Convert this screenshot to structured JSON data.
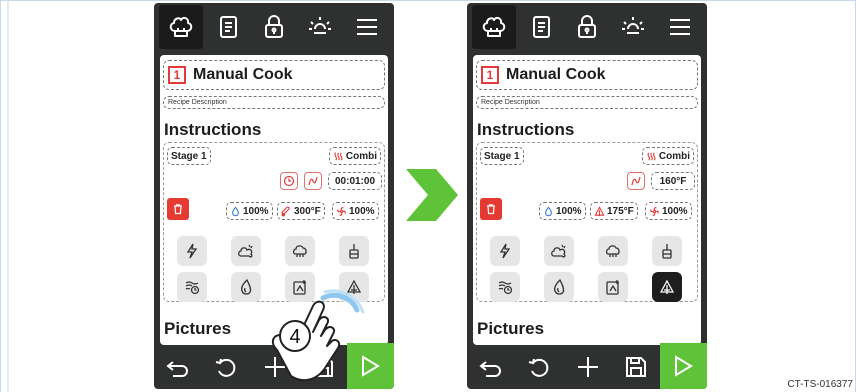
{
  "caption": "CT-TS-016377",
  "colors": {
    "accent_red": "#e03a3a",
    "play_green": "#5fc33a",
    "arrow_green": "#5fc33a",
    "frame_dark": "#2f3030"
  },
  "left": {
    "title_number": "1",
    "title": "Manual Cook",
    "description_placeholder": "Recipe Description",
    "instructions_heading": "Instructions",
    "stage_label": "Stage 1",
    "mode_label": "Combi",
    "timer_value": "00:01:00",
    "humidity_value": "100%",
    "temperature_value": "300°F",
    "fan_value": "100%",
    "pictures_heading": "Pictures",
    "step_badge": "4",
    "active_mode": "delta-t"
  },
  "right": {
    "title_number": "1",
    "title": "Manual Cook",
    "description_placeholder": "Recipe Description",
    "instructions_heading": "Instructions",
    "stage_label": "Stage 1",
    "mode_label": "Combi",
    "core_temp_value": "160°F",
    "humidity_value": "100%",
    "temperature_value": "175°F",
    "fan_value": "100%",
    "pictures_heading": "Pictures",
    "active_mode": "delta-t"
  },
  "icons": {
    "top": [
      "chef-hat-icon",
      "recipe-book-icon",
      "lock-icon",
      "brightness-icon",
      "menu-icon"
    ],
    "modes": [
      "lightning-icon",
      "steam-icon",
      "roast-icon",
      "core-probe-icon",
      "smoke-timer-icon",
      "drop-icon",
      "add-to-tray-icon",
      "delta-t-icon"
    ],
    "bottom": [
      "back-icon",
      "undo-icon",
      "add-icon",
      "save-icon",
      "play-icon"
    ]
  }
}
